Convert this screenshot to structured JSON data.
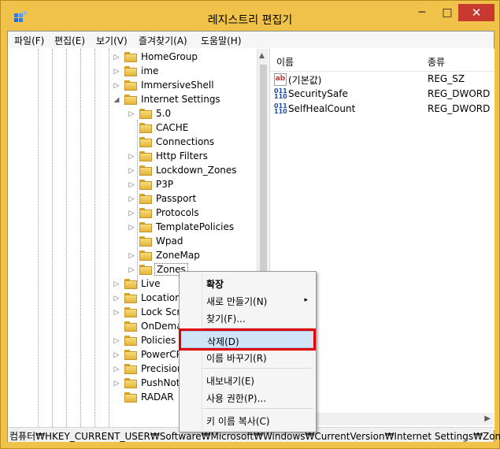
{
  "window": {
    "title": "레지스트리 편집기",
    "minimize": "─",
    "maximize": "□",
    "close": "✕"
  },
  "menubar": [
    "파일(F)",
    "편집(E)",
    "보기(V)",
    "즐겨찾기(A)",
    "도움말(H)"
  ],
  "tree": {
    "items": [
      {
        "label": "HomeGroup",
        "expander": "▷"
      },
      {
        "label": "ime",
        "expander": "▷"
      },
      {
        "label": "ImmersiveShell",
        "expander": "▷"
      },
      {
        "label": "Internet Settings",
        "expander": "◢"
      },
      {
        "label": "5.0",
        "expander": "▷"
      },
      {
        "label": "CACHE",
        "expander": ""
      },
      {
        "label": "Connections",
        "expander": ""
      },
      {
        "label": "Http Filters",
        "expander": "▷"
      },
      {
        "label": "Lockdown_Zones",
        "expander": "▷"
      },
      {
        "label": "P3P",
        "expander": "▷"
      },
      {
        "label": "Passport",
        "expander": "▷"
      },
      {
        "label": "Protocols",
        "expander": "▷"
      },
      {
        "label": "TemplatePolicies",
        "expander": "▷"
      },
      {
        "label": "Wpad",
        "expander": ""
      },
      {
        "label": "ZoneMap",
        "expander": "▷"
      },
      {
        "label": "Zones",
        "expander": "▷"
      },
      {
        "label": "Live",
        "expander": "▷"
      },
      {
        "label": "LocationP",
        "expander": "▷"
      },
      {
        "label": "Lock Scre",
        "expander": "▷"
      },
      {
        "label": "OnDema",
        "expander": ""
      },
      {
        "label": "Policies",
        "expander": "▷"
      },
      {
        "label": "PowerCP",
        "expander": "▷"
      },
      {
        "label": "Precision",
        "expander": "▷"
      },
      {
        "label": "PushNoti",
        "expander": "▷"
      },
      {
        "label": "RADAR",
        "expander": ""
      }
    ]
  },
  "list": {
    "col_name": "이름",
    "col_type": "종류",
    "rows": [
      {
        "name": "(기본값)",
        "type": "REG_SZ",
        "icon": "ab"
      },
      {
        "name": "SecuritySafe",
        "type": "REG_DWORD",
        "icon": "011\n110"
      },
      {
        "name": "SelfHealCount",
        "type": "REG_DWORD",
        "icon": "011\n110"
      }
    ]
  },
  "context_menu": {
    "items": [
      "확장",
      "새로 만들기(N)",
      "찾기(F)...",
      "삭제(D)",
      "이름 바꾸기(R)",
      "내보내기(E)",
      "사용 권한(P)...",
      "키 이름 복사(C)"
    ],
    "submenu_arrow": "▸"
  },
  "scroll": {
    "up": "▲",
    "left": "◀",
    "right": "▶"
  },
  "status": {
    "path": "컴퓨터₩HKEY_CURRENT_USER₩Software₩Microsoft₩Windows₩CurrentVersion₩Internet Settings₩Zones"
  },
  "colors": {
    "frame": "#f0c24a",
    "close": "#c83a2f",
    "highlight_box": "#e00000"
  }
}
